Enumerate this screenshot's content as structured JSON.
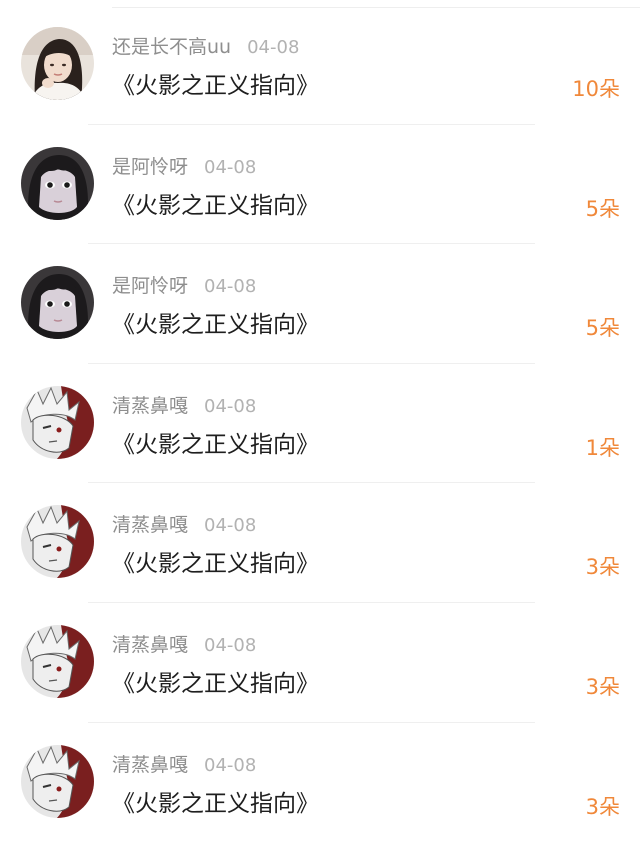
{
  "colors": {
    "username": "#8e8e8e",
    "date": "#b2b2b2",
    "title": "#1f1f1f",
    "count": "#f0883a",
    "divider": "#efefef"
  },
  "records": [
    {
      "username": "还是长不高uu",
      "date": "04-08",
      "title": "《火影之正义指向》",
      "count": "10朵",
      "avatar": "girl-portrait-avatar"
    },
    {
      "username": "是阿怜呀",
      "date": "04-08",
      "title": "《火影之正义指向》",
      "count": "5朵",
      "avatar": "anime-girl-avatar"
    },
    {
      "username": "是阿怜呀",
      "date": "04-08",
      "title": "《火影之正义指向》",
      "count": "5朵",
      "avatar": "anime-girl-avatar"
    },
    {
      "username": "清蒸鼻嘎",
      "date": "04-08",
      "title": "《火影之正义指向》",
      "count": "1朵",
      "avatar": "red-white-anime-avatar"
    },
    {
      "username": "清蒸鼻嘎",
      "date": "04-08",
      "title": "《火影之正义指向》",
      "count": "3朵",
      "avatar": "red-white-anime-avatar"
    },
    {
      "username": "清蒸鼻嘎",
      "date": "04-08",
      "title": "《火影之正义指向》",
      "count": "3朵",
      "avatar": "red-white-anime-avatar"
    },
    {
      "username": "清蒸鼻嘎",
      "date": "04-08",
      "title": "《火影之正义指向》",
      "count": "3朵",
      "avatar": "red-white-anime-avatar"
    }
  ]
}
